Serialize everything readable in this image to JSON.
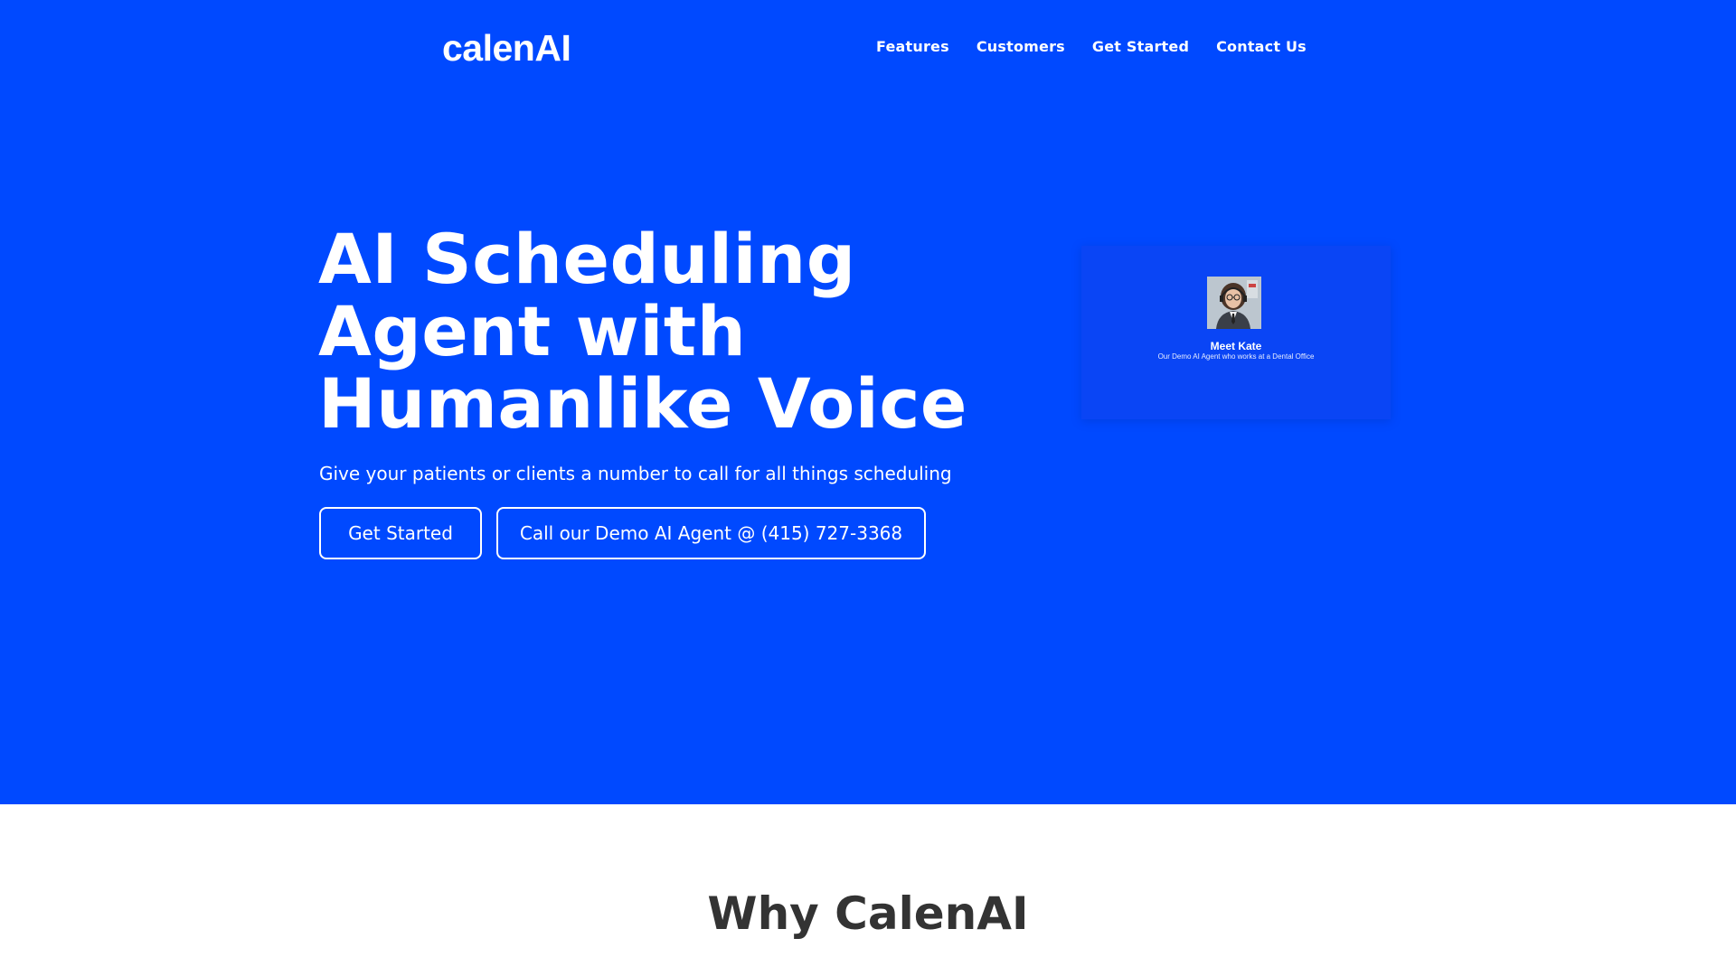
{
  "brand": {
    "logo_text": "calenAI",
    "accent": "#0049FF"
  },
  "nav": {
    "items": [
      {
        "label": "Features"
      },
      {
        "label": "Customers"
      },
      {
        "label": "Get Started"
      },
      {
        "label": "Contact Us"
      }
    ]
  },
  "hero": {
    "headline_lines": [
      "AI Scheduling",
      "Agent with",
      "Humanlike Voice"
    ],
    "subtitle": "Give your patients or clients a number to call for all things scheduling",
    "primary_button": "Get Started",
    "demo_button": "Call our Demo AI Agent @ (415) 727-3368"
  },
  "agent_card": {
    "name": "Meet Kate",
    "description": "Our Demo AI Agent  who works at a Dental Office",
    "avatar_icon": "woman-avatar-with-headset"
  },
  "why": {
    "title": "Why CalenAI"
  }
}
